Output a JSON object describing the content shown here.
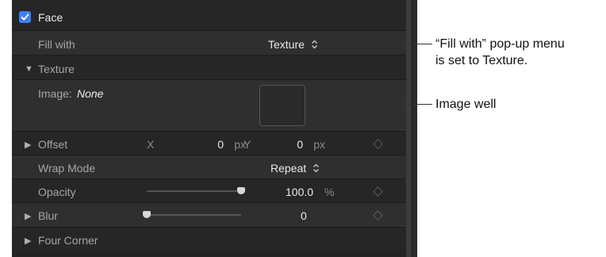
{
  "face": {
    "label": "Face",
    "checked": true
  },
  "fill_with": {
    "label": "Fill with",
    "value": "Texture"
  },
  "texture": {
    "label": "Texture"
  },
  "image": {
    "label": "Image:",
    "value": "None"
  },
  "offset": {
    "label": "Offset",
    "x_label": "X",
    "x_value": "0",
    "x_unit": "px",
    "y_label": "Y",
    "y_value": "0",
    "y_unit": "px"
  },
  "wrap_mode": {
    "label": "Wrap Mode",
    "value": "Repeat"
  },
  "opacity": {
    "label": "Opacity",
    "value": "100.0",
    "unit": "%",
    "level": 1.0
  },
  "blur": {
    "label": "Blur",
    "value": "0",
    "level": 0.0
  },
  "four_corner": {
    "label": "Four Corner"
  },
  "callouts": {
    "fill_with": [
      "“Fill with” pop-up menu",
      "is set to Texture."
    ],
    "image_well": "Image well"
  },
  "colors": {
    "checkbox_accent": "#3f7ff0",
    "panel_bg": "#242424"
  }
}
